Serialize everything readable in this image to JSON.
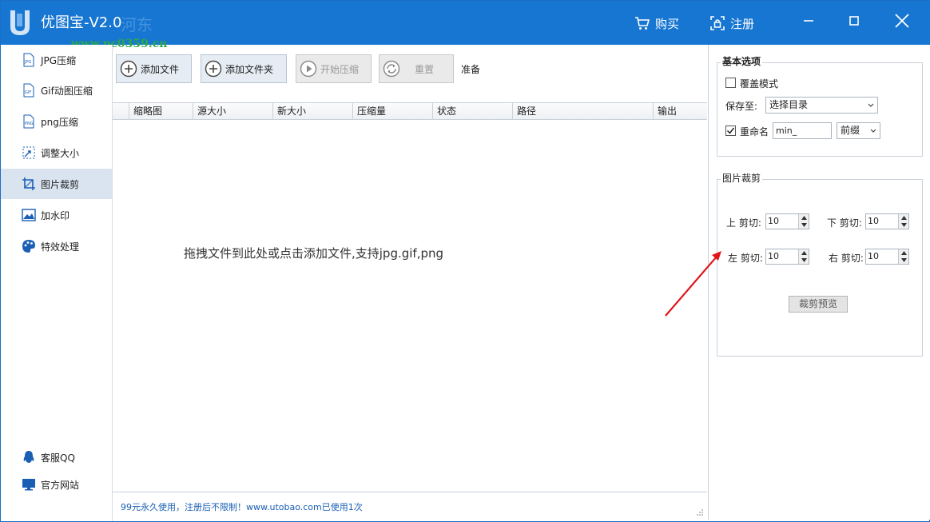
{
  "titlebar": {
    "title": "优图宝-V2.0",
    "watermark": "www.pc0359.cn",
    "buy_label": "购买",
    "register_label": "注册"
  },
  "sidebar": {
    "items": [
      {
        "label": "JPG压缩",
        "icon": "jpg-icon"
      },
      {
        "label": "Gif动图压缩",
        "icon": "gif-icon"
      },
      {
        "label": "png压缩",
        "icon": "png-icon"
      },
      {
        "label": "调整大小",
        "icon": "resize-icon"
      },
      {
        "label": "图片裁剪",
        "icon": "crop-icon",
        "active": true
      },
      {
        "label": "加水印",
        "icon": "image-icon"
      },
      {
        "label": "特效处理",
        "icon": "palette-icon"
      }
    ],
    "bottom": [
      {
        "label": "客服QQ",
        "icon": "qq-icon"
      },
      {
        "label": "官方网站",
        "icon": "monitor-icon"
      }
    ]
  },
  "toolbar": {
    "add_file": "添加文件",
    "add_folder": "添加文件夹",
    "start": "开始压缩",
    "reset": "重置",
    "status": "准备"
  },
  "table": {
    "columns": [
      "缩略图",
      "源大小",
      "新大小",
      "压缩量",
      "状态",
      "路径",
      "输出"
    ],
    "rows": [],
    "empty_hint": "拖拽文件到此处或点击添加文件,支持jpg.gif,png"
  },
  "statusbar": {
    "text": "99元永久使用，注册后不限制！www.utobao.com已使用1次"
  },
  "options": {
    "title": "基本选项",
    "overwrite_label": "覆盖模式",
    "overwrite_checked": false,
    "save_to_label": "保存至:",
    "save_to_value": "选择目录",
    "rename_label": "重命名",
    "rename_checked": true,
    "rename_value": "min_",
    "rename_mode": "前缀"
  },
  "crop": {
    "title": "图片裁剪",
    "top_label": "上 剪切:",
    "top_value": "10",
    "bottom_label": "下 剪切:",
    "bottom_value": "10",
    "left_label": "左 剪切:",
    "left_value": "10",
    "right_label": "右 剪切:",
    "right_value": "10",
    "preview_label": "裁剪预览"
  },
  "colors": {
    "titlebar": "#1776d1",
    "active_item": "#d9e4f0",
    "annotation_arrow": "#e0161b"
  }
}
